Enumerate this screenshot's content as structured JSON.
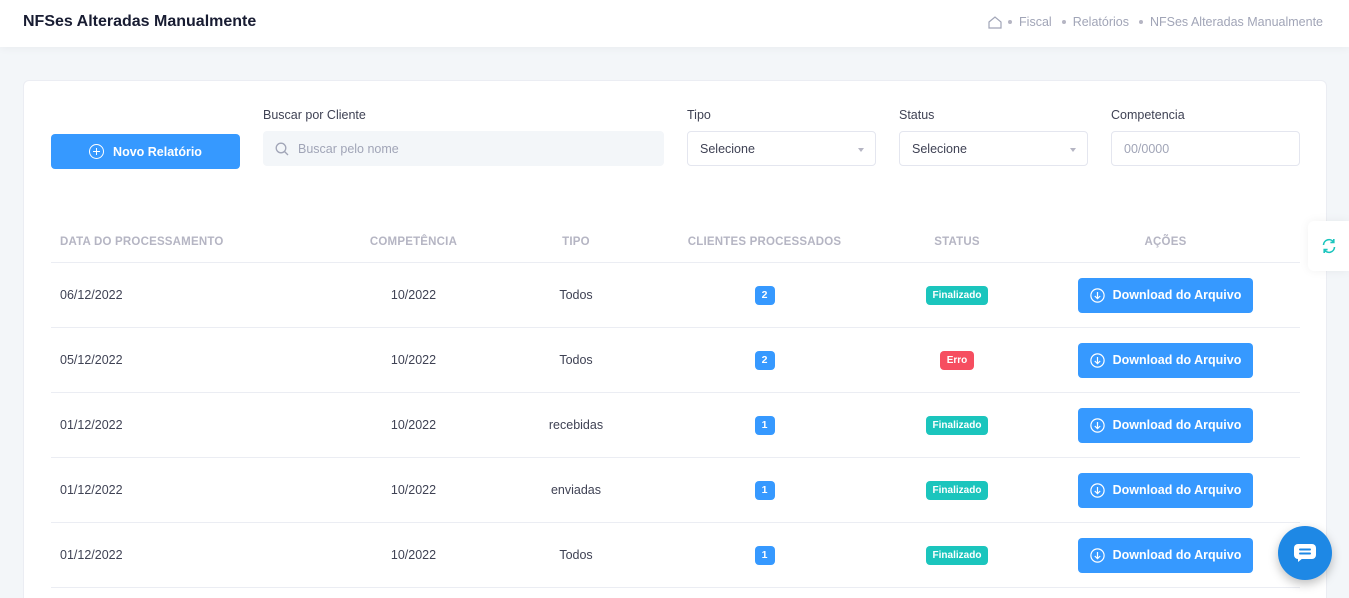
{
  "header": {
    "title": "NFSes Alteradas Manualmente",
    "breadcrumb": [
      "Fiscal",
      "Relatórios",
      "NFSes Alteradas Manualmente"
    ]
  },
  "toolbar": {
    "new_report_label": "Novo Relatório",
    "search_label": "Buscar por Cliente",
    "search_placeholder": "Buscar pelo nome",
    "tipo_label": "Tipo",
    "tipo_value": "Selecione",
    "status_label": "Status",
    "status_value": "Selecione",
    "competencia_label": "Competencia",
    "competencia_placeholder": "00/0000"
  },
  "table": {
    "columns": [
      "DATA DO PROCESSAMENTO",
      "COMPETÊNCIA",
      "TIPO",
      "CLIENTES PROCESSADOS",
      "STATUS",
      "AÇÕES"
    ],
    "rows": [
      {
        "date": "06/12/2022",
        "competencia": "10/2022",
        "tipo": "Todos",
        "clientes": "2",
        "status": "Finalizado",
        "action": "Download do Arquivo"
      },
      {
        "date": "05/12/2022",
        "competencia": "10/2022",
        "tipo": "Todos",
        "clientes": "2",
        "status": "Erro",
        "action": "Download do Arquivo"
      },
      {
        "date": "01/12/2022",
        "competencia": "10/2022",
        "tipo": "recebidas",
        "clientes": "1",
        "status": "Finalizado",
        "action": "Download do Arquivo"
      },
      {
        "date": "01/12/2022",
        "competencia": "10/2022",
        "tipo": "enviadas",
        "clientes": "1",
        "status": "Finalizado",
        "action": "Download do Arquivo"
      },
      {
        "date": "01/12/2022",
        "competencia": "10/2022",
        "tipo": "Todos",
        "clientes": "1",
        "status": "Finalizado",
        "action": "Download do Arquivo"
      }
    ]
  },
  "colors": {
    "primary": "#3699ff",
    "success": "#1bc5bd",
    "danger": "#f64e60",
    "chat": "#1e88e5"
  },
  "icons": [
    "home-icon",
    "plus-circle-icon",
    "search-icon",
    "chevron-down-icon",
    "download-icon",
    "refresh-icon",
    "chat-icon"
  ]
}
